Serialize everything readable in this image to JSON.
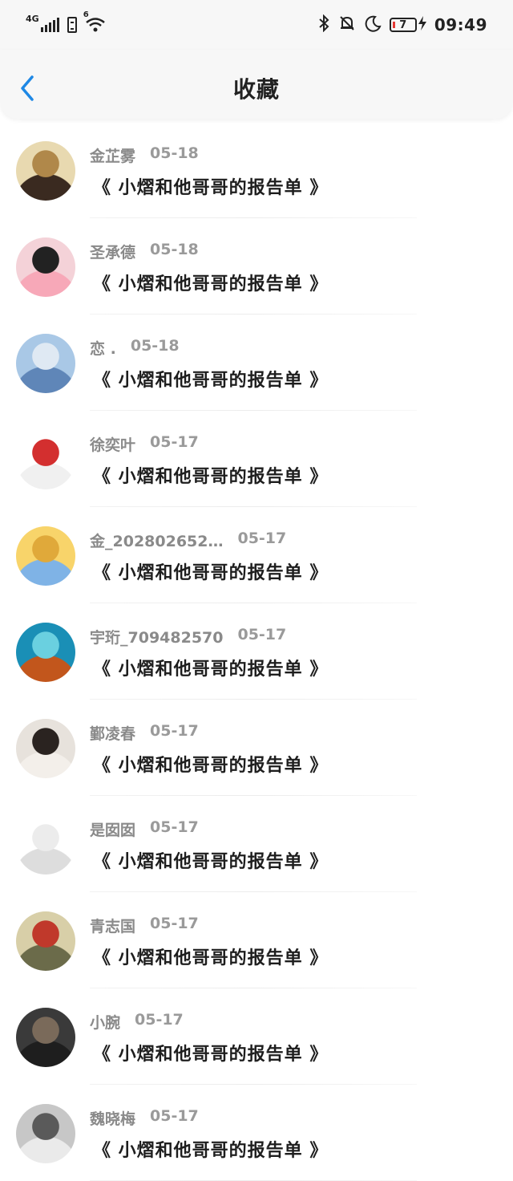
{
  "status_bar": {
    "network": "4G",
    "wifi_badge": "6",
    "battery_level": "7",
    "time": "09:49",
    "icons": [
      "signal-icon",
      "sim-icon",
      "wifi-icon",
      "bluetooth-icon",
      "mute-icon",
      "moon-icon",
      "battery-icon",
      "charging-icon"
    ]
  },
  "header": {
    "title": "收藏",
    "back_icon": "chevron-left-icon",
    "accent_color": "#1e88e5"
  },
  "items": [
    {
      "user": "金芷雾",
      "date": "05-18",
      "title": "《 小熠和他哥哥的报告单 》",
      "avatar_colors": [
        "#e8d9b0",
        "#b0884a",
        "#3a2a20"
      ]
    },
    {
      "user": "圣承德",
      "date": "05-18",
      "title": "《 小熠和他哥哥的报告单 》",
      "avatar_colors": [
        "#f4d2d8",
        "#222222",
        "#f7a8b8"
      ]
    },
    {
      "user": "恋 .",
      "date": "05-18",
      "title": "《 小熠和他哥哥的报告单 》",
      "avatar_colors": [
        "#a9c8e6",
        "#dfe9f3",
        "#5f86b8"
      ]
    },
    {
      "user": "徐奕叶",
      "date": "05-17",
      "title": "《 小熠和他哥哥的报告单 》",
      "avatar_colors": [
        "#ffffff",
        "#d32f2f",
        "#f0f0f0"
      ]
    },
    {
      "user": "金_2028026​52…",
      "date": "05-17",
      "title": "《 小熠和他哥哥的报告单 》",
      "avatar_colors": [
        "#f8d46a",
        "#e0a93a",
        "#7fb3e6"
      ]
    },
    {
      "user": "宇珩_709482570",
      "date": "05-17",
      "title": "《 小熠和他哥哥的报告单 》",
      "avatar_colors": [
        "#1a8fb6",
        "#6ad0e0",
        "#c2561c"
      ]
    },
    {
      "user": "鄞凌春",
      "date": "05-17",
      "title": "《 小熠和他哥哥的报告单 》",
      "avatar_colors": [
        "#e7e2dc",
        "#2a2320",
        "#f3efea"
      ]
    },
    {
      "user": "是囡囡",
      "date": "05-17",
      "title": "《 小熠和他哥哥的报告单 》",
      "avatar_colors": [
        "#ffffff",
        "#ececec",
        "#dddddd"
      ]
    },
    {
      "user": "青志国",
      "date": "05-17",
      "title": "《 小熠和他哥哥的报告单 》",
      "avatar_colors": [
        "#d8cfa8",
        "#c0392b",
        "#6b6b4a"
      ]
    },
    {
      "user": "小腕",
      "date": "05-17",
      "title": "《 小熠和他哥哥的报告单 》",
      "avatar_colors": [
        "#3a3a3a",
        "#7a6a5a",
        "#1e1e1e"
      ]
    },
    {
      "user": "魏晓梅",
      "date": "05-17",
      "title": "《 小熠和他哥哥的报告单 》",
      "avatar_colors": [
        "#c7c7c7",
        "#5a5a5a",
        "#eaeaea"
      ]
    }
  ]
}
